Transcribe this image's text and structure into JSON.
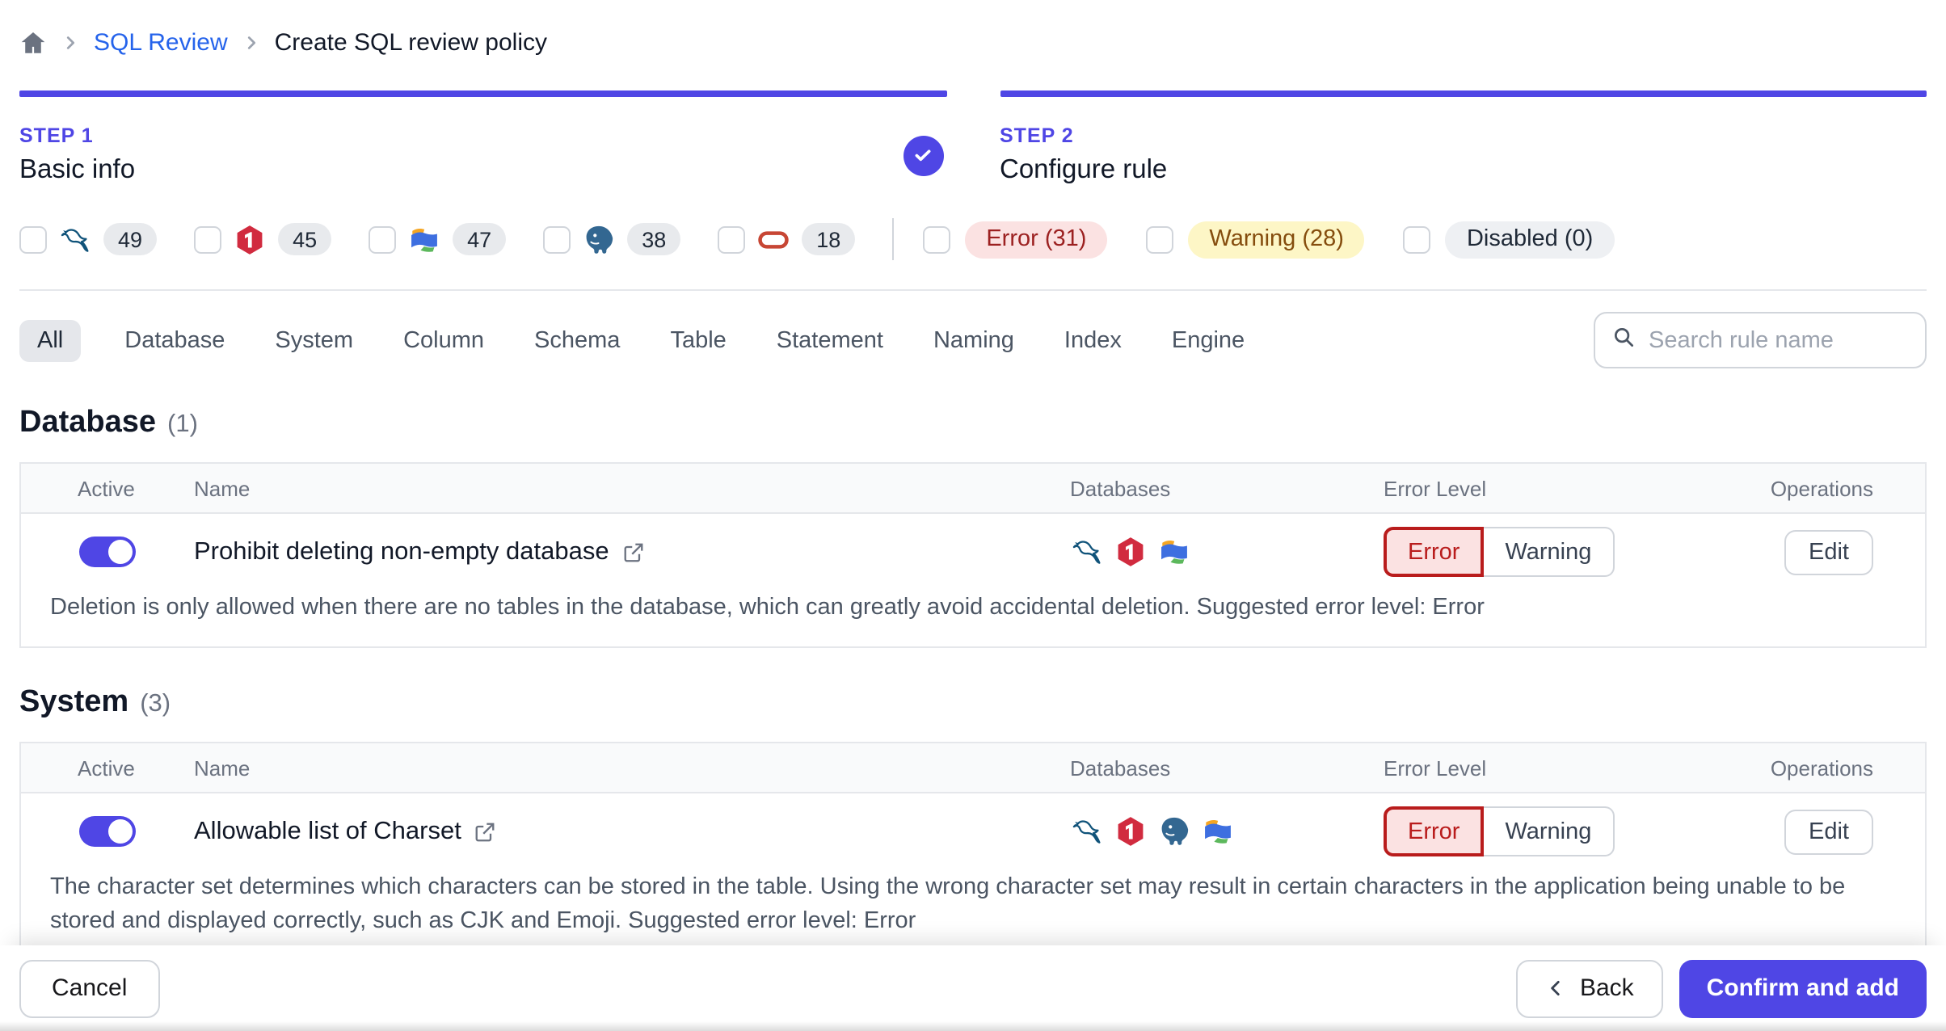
{
  "breadcrumb": {
    "items": [
      "SQL Review",
      "Create SQL review policy"
    ]
  },
  "steps": [
    {
      "label": "STEP 1",
      "title": "Basic info",
      "completed": true
    },
    {
      "label": "STEP 2",
      "title": "Configure rule",
      "completed": false
    }
  ],
  "filters": {
    "engines": [
      {
        "name": "mysql",
        "count": "49"
      },
      {
        "name": "tidb",
        "count": "45"
      },
      {
        "name": "oceanbase",
        "count": "47"
      },
      {
        "name": "postgres",
        "count": "38"
      },
      {
        "name": "oracle",
        "count": "18"
      }
    ],
    "levels": [
      {
        "label": "Error (31)",
        "type": "error"
      },
      {
        "label": "Warning (28)",
        "type": "warning"
      },
      {
        "label": "Disabled (0)",
        "type": "disabled"
      }
    ]
  },
  "tabs": {
    "selected": "All",
    "items": [
      "All",
      "Database",
      "System",
      "Column",
      "Schema",
      "Table",
      "Statement",
      "Naming",
      "Index",
      "Engine"
    ]
  },
  "search": {
    "placeholder": "Search rule name"
  },
  "sections": [
    {
      "title": "Database",
      "count": "(1)",
      "columns": {
        "active": "Active",
        "name": "Name",
        "databases": "Databases",
        "error_level": "Error Level",
        "operations": "Operations"
      },
      "rules": [
        {
          "name": "Prohibit deleting non-empty database",
          "active": true,
          "engines": [
            "mysql",
            "tidb",
            "oceanbase"
          ],
          "selected_level": "Error",
          "level_options": {
            "error": "Error",
            "warning": "Warning"
          },
          "edit": "Edit",
          "description": "Deletion is only allowed when there are no tables in the database, which can greatly avoid accidental deletion. Suggested error level: Error"
        }
      ]
    },
    {
      "title": "System",
      "count": "(3)",
      "columns": {
        "active": "Active",
        "name": "Name",
        "databases": "Databases",
        "error_level": "Error Level",
        "operations": "Operations"
      },
      "rules": [
        {
          "name": "Allowable list of Charset",
          "active": true,
          "engines": [
            "mysql",
            "tidb",
            "postgres",
            "oceanbase"
          ],
          "selected_level": "Error",
          "level_options": {
            "error": "Error",
            "warning": "Warning"
          },
          "edit": "Edit",
          "description": "The character set determines which characters can be stored in the table. Using the wrong character set may result in certain characters in the application being unable to be stored and displayed correctly, such as CJK and Emoji. Suggested error level: Error"
        }
      ]
    }
  ],
  "footer": {
    "cancel": "Cancel",
    "back": "Back",
    "confirm": "Confirm and add"
  },
  "colors": {
    "accent": "#4f46e5",
    "breadcrumb_link": "#2563eb",
    "error_text": "#b91c1c",
    "error_bg": "#fbe2e2",
    "warning_text": "#854d0e",
    "warning_bg": "#fdf6c6",
    "disabled_bg": "#eef0f3"
  }
}
